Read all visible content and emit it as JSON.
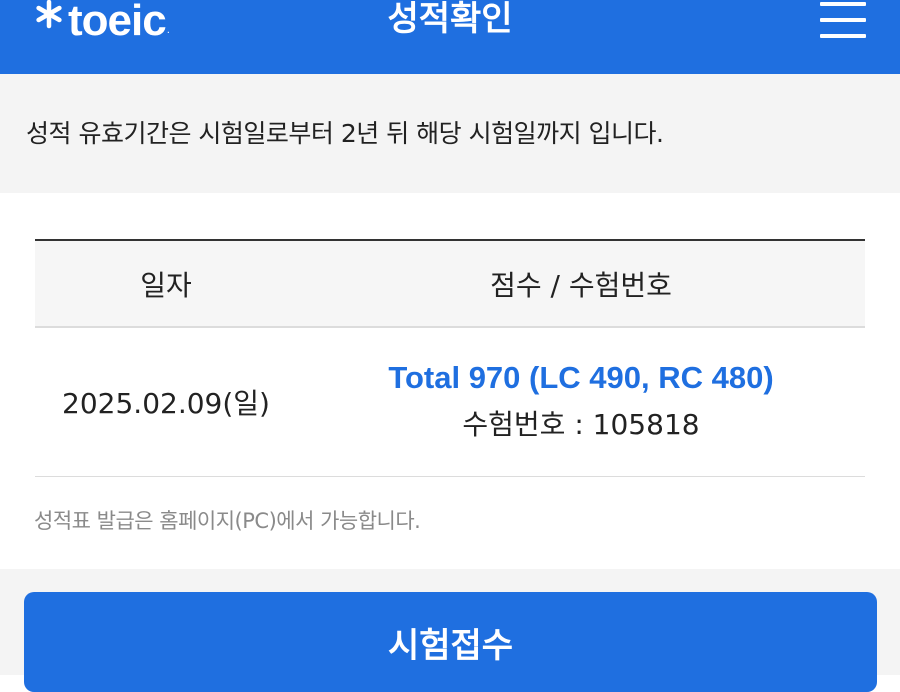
{
  "header": {
    "logo_text": "toeic",
    "logo_registered": ".",
    "title": "성적확인",
    "menu_icon": "hamburger-menu-icon",
    "background_color": "#1f6fe0"
  },
  "notice": {
    "text": "성적 유효기간은 시험일로부터 2년 뒤 해당 시험일까지 입니다."
  },
  "results_table": {
    "headers": [
      "일자",
      "점수 / 수험번호"
    ],
    "rows": [
      {
        "date": "2025.02.09(일)",
        "score_line": "Total 970 (LC 490, RC 480)",
        "exam_number_line": "수험번호 : 105818"
      }
    ]
  },
  "footnote": "성적표 발급은 홈페이지(PC)에서 가능합니다.",
  "apply_button": {
    "label": "시험접수"
  },
  "colors": {
    "accent": "#1f6fe0",
    "score_text": "#1f6fe0",
    "muted_text": "#8a8a8a"
  }
}
